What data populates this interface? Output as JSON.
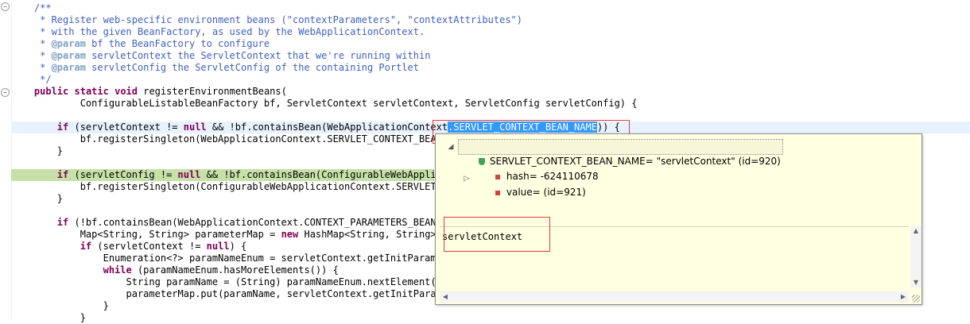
{
  "editor": {
    "lines": [
      {
        "text": "    /**",
        "cls": "c"
      },
      {
        "text": "     * Register web-specific environment beans (\"contextParameters\", \"contextAttributes\")",
        "cls": "c"
      },
      {
        "text": "     * with the given BeanFactory, as used by the WebApplicationContext.",
        "cls": "c"
      },
      {
        "text": "     * @param bf the BeanFactory to configure",
        "cls": "c"
      },
      {
        "text": "     * @param servletContext the ServletContext that we're running within",
        "cls": "c"
      },
      {
        "text": "     * @param servletConfig the ServletConfig of the containing Portlet",
        "cls": "c"
      },
      {
        "text": "     */",
        "cls": "c"
      },
      {
        "text": "    public static void registerEnvironmentBeans(",
        "cls": ""
      },
      {
        "text": "            ConfigurableListableBeanFactory bf, ServletContext servletContext, ServletConfig servletConfig) {",
        "cls": ""
      },
      {
        "text": "",
        "cls": ""
      },
      {
        "text": "        if (servletContext != null && !bf.containsBean(WebApplicationContext.SERVLET_CONTEXT_BEAN_NAME)) {",
        "cls": ""
      },
      {
        "text": "            bf.registerSingleton(WebApplicationContext.SERVLET_CONTEXT_BEAN_",
        "cls": ""
      },
      {
        "text": "        }",
        "cls": ""
      },
      {
        "text": "",
        "cls": ""
      },
      {
        "text": "        if (servletConfig != null && !bf.containsBean(ConfigurableWebApplica",
        "cls": ""
      },
      {
        "text": "            bf.registerSingleton(ConfigurableWebApplicationContext.SERVLET_C",
        "cls": ""
      },
      {
        "text": "        }",
        "cls": ""
      },
      {
        "text": "",
        "cls": ""
      },
      {
        "text": "        if (!bf.containsBean(WebApplicationContext.CONTEXT_PARAMETERS_BEAN_N",
        "cls": ""
      },
      {
        "text": "            Map<String, String> parameterMap = new HashMap<String, String>()",
        "cls": ""
      },
      {
        "text": "            if (servletContext != null) {",
        "cls": ""
      },
      {
        "text": "                Enumeration<?> paramNameEnum = servletContext.getInitParamet",
        "cls": ""
      },
      {
        "text": "                while (paramNameEnum.hasMoreElements()) {",
        "cls": ""
      },
      {
        "text": "                    String paramName = (String) paramNameEnum.nextElement();",
        "cls": ""
      },
      {
        "text": "                    parameterMap.put(paramName, servletContext.getInitParame",
        "cls": ""
      },
      {
        "text": "                }",
        "cls": ""
      },
      {
        "text": "            }",
        "cls": ""
      }
    ]
  },
  "popup": {
    "root_label": "SERVLET_CONTEXT_BEAN_NAME= \"servletContext\" (id=920)",
    "root_badge": "SF",
    "hash_label": "hash= -624110678",
    "value_label": "value= (id=921)",
    "value_badge": "F",
    "detail_text": "servletContext"
  },
  "colors": {
    "comment": "#3f5fbf",
    "keyword": "#7f0055",
    "selection": "#3399ff",
    "current_line": "#e8f2fe",
    "breakpoint_line": "#c7e0a7",
    "popup_bg": "#ffffe1",
    "highlight_box": "#e23a3a"
  }
}
